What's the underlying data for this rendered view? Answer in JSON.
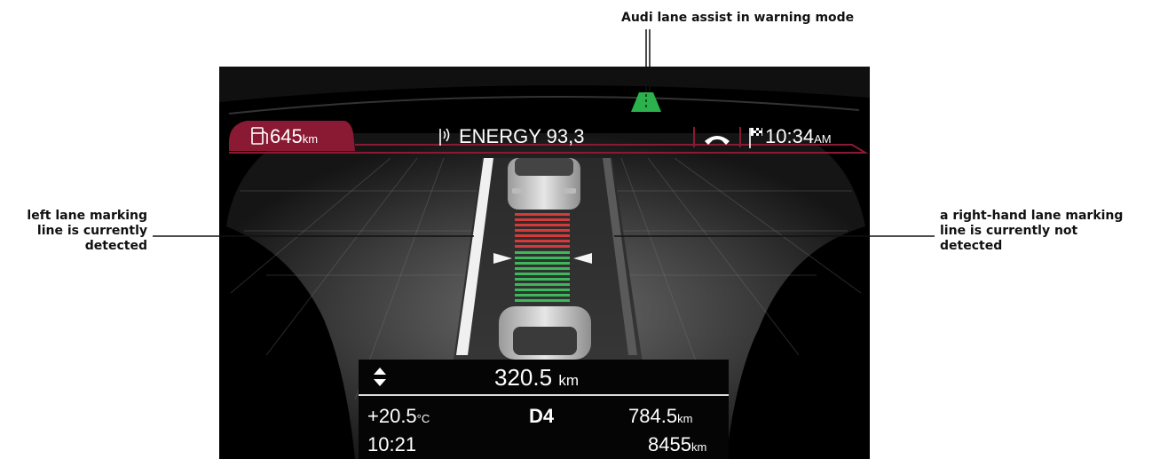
{
  "annotations": {
    "top": "Audi lane assist in warning mode",
    "left": [
      "left lane marking",
      "line is currently",
      "detected"
    ],
    "right": [
      "a right-hand lane marking",
      "line is currently not",
      "detected"
    ]
  },
  "status_bar": {
    "range_value": "645",
    "range_unit": "km",
    "radio_station": "ENERGY 93,3",
    "clock_value": "10:34",
    "clock_suffix": "AM"
  },
  "trip_panel": {
    "distance_value": "320.5",
    "distance_unit": "km",
    "temperature_value": "+20.5",
    "temperature_unit": "°C",
    "gear": "D4",
    "odometer_value": "784.5",
    "odometer_unit": "km",
    "time": "10:21",
    "total_value": "8455",
    "total_unit": "km"
  },
  "colors": {
    "status_accent": "#8a1a33",
    "lane_assist_green": "#2bb24c",
    "warning_red": "#d63a3a",
    "ok_green": "#3db85a"
  },
  "icons": [
    "fuel-pump-icon",
    "antenna-icon",
    "phone-handset-icon",
    "finish-flag-icon",
    "up-down-arrows-icon",
    "lane-assist-icon"
  ]
}
